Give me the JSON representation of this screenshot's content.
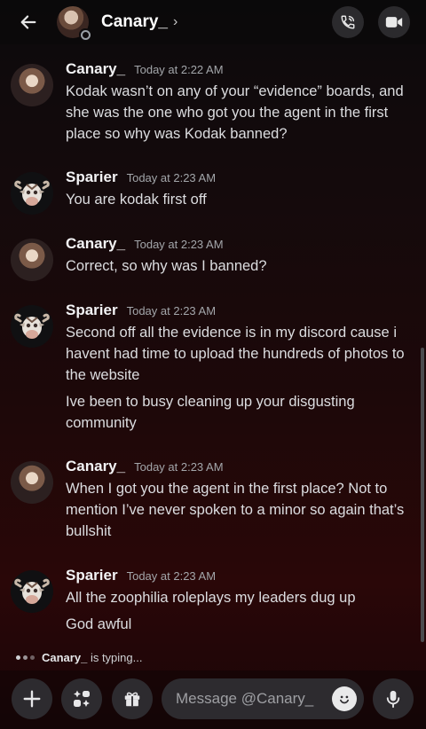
{
  "header": {
    "title": "Canary_",
    "chevron": "›",
    "back_icon": "arrow-left-icon",
    "call_icon": "phone-icon",
    "video_icon": "video-camera-icon"
  },
  "messages": [
    {
      "author": "Canary_",
      "time": "Today at 2:22 AM",
      "lines": [
        "Kodak wasn’t on any of your “evidence” boards, and she was the one who got you the agent in the first place so why was Kodak banned?"
      ]
    },
    {
      "author": "Sparier",
      "time": "Today at 2:23 AM",
      "lines": [
        "You are kodak first off"
      ]
    },
    {
      "author": "Canary_",
      "time": "Today at 2:23 AM",
      "lines": [
        "Correct, so why was I banned?"
      ]
    },
    {
      "author": "Sparier",
      "time": "Today at 2:23 AM",
      "lines": [
        "Second off all the evidence is in my discord cause i havent had time to upload the hundreds of photos to the website",
        "Ive been to busy cleaning up your disgusting community"
      ]
    },
    {
      "author": "Canary_",
      "time": "Today at 2:23 AM",
      "lines": [
        "When I got you the agent in the first place? Not to mention I’ve never spoken to a minor so again that’s bullshit"
      ]
    },
    {
      "author": "Sparier",
      "time": "Today at 2:23 AM",
      "lines": [
        "All the zoophilia roleplays my leaders dug up",
        "God awful"
      ]
    }
  ],
  "typing": {
    "user": "Canary_",
    "suffix": "is typing..."
  },
  "composer": {
    "placeholder": "Message @Canary_",
    "add_icon": "plus-icon",
    "apps_icon": "apps-icon",
    "gift_icon": "gift-icon",
    "emoji_icon": "emoji-icon",
    "mic_icon": "microphone-icon"
  },
  "colors": {
    "accent_bg": "#2d2b2f",
    "text": "#dcdde0",
    "muted": "#a3a6aa"
  }
}
